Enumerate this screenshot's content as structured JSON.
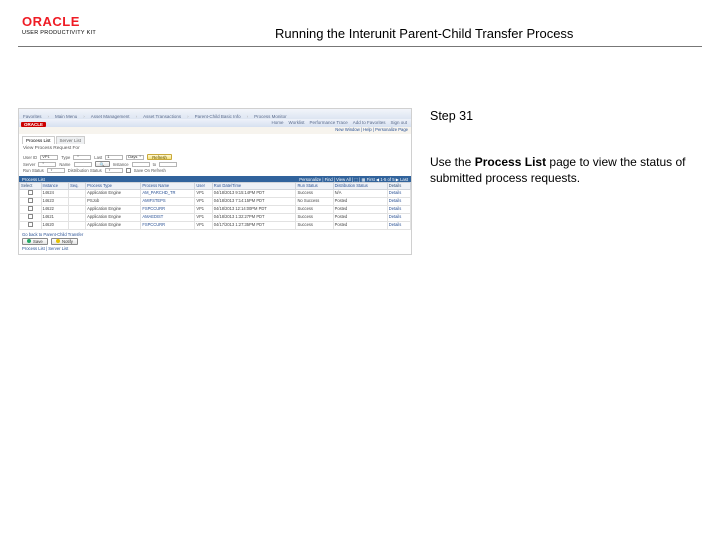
{
  "brand": {
    "name": "ORACLE",
    "kit": "USER PRODUCTIVITY KIT"
  },
  "title": "Running the Interunit Parent-Child Transfer Process",
  "right": {
    "step": "Step 31",
    "line1a": "Use the ",
    "line1b": "Process List",
    "line1c": " page to view the status of submitted process requests."
  },
  "mini": {
    "crumbs": [
      "Favorites",
      "Main Menu",
      "Asset Management",
      "Asset Transactions",
      "Parent-Child Basic Info",
      "Process Monitor"
    ],
    "brand": "ORACLE",
    "nav": [
      "Home",
      "Worklist",
      "Performance Trace",
      "Add to Favorites",
      "Sign out"
    ],
    "newwindow": "New Window | Help | Personalize Page",
    "tabs": [
      "Process List",
      "Server List"
    ],
    "panel_title": "View Process Request For",
    "filters": {
      "userid_l": "User ID",
      "userid_v": "VP1",
      "type_l": "Type",
      "last_l": "Last",
      "last_n": "1",
      "last_unit": "Days",
      "refresh": "Refresh",
      "server_l": "Server",
      "name_l": "Name",
      "name_btn": "🔍",
      "instance_lbl": "Instance",
      "to_lbl": "to",
      "runstatus_l": "Run Status",
      "diststatus_l": "Distribution Status",
      "saveonrefresh": "Save On Refresh"
    },
    "grid": {
      "title": "Process List",
      "range": "Personalize | Find | View All | ⬚ | ▦   First ◀ 1-5 of 5 ▶ Last",
      "cols": [
        "Select",
        "Instance",
        "Seq.",
        "Process Type",
        "Process Name",
        "User",
        "Run Date/Time",
        "Run Status",
        "Distribution Status",
        "Details"
      ],
      "rows": [
        {
          "sel": "",
          "inst": "14624",
          "seq": "",
          "ptype": "Application Engine",
          "pname": "AM_PARCHD_TR",
          "user": "VP1",
          "rdt": "04/18/2013  9:15:14PM PDT",
          "rstat": "Success",
          "dstat": "N/A",
          "det": "Details"
        },
        {
          "sel": "",
          "inst": "14623",
          "seq": "",
          "ptype": "PSJob",
          "pname": "AMIFSTEPS",
          "user": "VP1",
          "rdt": "04/18/2013  7:14:15PM PDT",
          "rstat": "No Success",
          "dstat": "Posted",
          "det": "Details"
        },
        {
          "sel": "",
          "inst": "14622",
          "seq": "",
          "ptype": "Application Engine",
          "pname": "FSPCCURR",
          "user": "VP1",
          "rdt": "04/18/2013  12:14:00PM PDT",
          "rstat": "Success",
          "dstat": "Posted",
          "det": "Details"
        },
        {
          "sel": "",
          "inst": "14621",
          "seq": "",
          "ptype": "Application Engine",
          "pname": "AMAEDIST",
          "user": "VP1",
          "rdt": "04/18/2013  1:32:27PM PDT",
          "rstat": "Success",
          "dstat": "Posted",
          "det": "Details"
        },
        {
          "sel": "",
          "inst": "14620",
          "seq": "",
          "ptype": "Application Engine",
          "pname": "FSPCCURR",
          "user": "VP1",
          "rdt": "04/17/2013  1:27:35PM PDT",
          "rstat": "Success",
          "dstat": "Posted",
          "det": "Details"
        }
      ]
    },
    "footer": {
      "goback": "Go back to Parent-Child Transfer",
      "save": "Save",
      "notify": "Notify",
      "tablinks": "Process List | Server List"
    }
  }
}
